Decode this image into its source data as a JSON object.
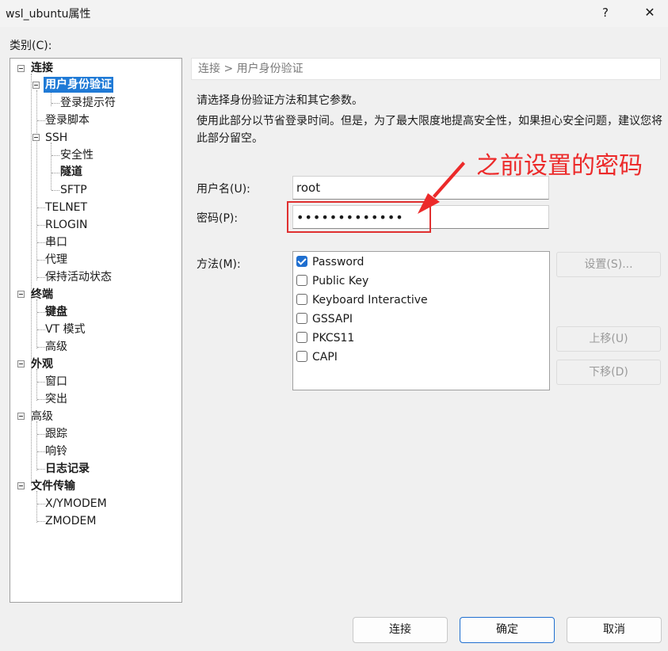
{
  "window": {
    "title": "wsl_ubuntu属性",
    "help_label": "?",
    "close_label": "✕"
  },
  "category_label": "类别(C):",
  "tree": {
    "items": [
      {
        "label": "连接"
      },
      {
        "label": "用户身份验证"
      },
      {
        "label": "登录提示符"
      },
      {
        "label": "登录脚本"
      },
      {
        "label": "SSH"
      },
      {
        "label": "安全性"
      },
      {
        "label": "隧道"
      },
      {
        "label": "SFTP"
      },
      {
        "label": "TELNET"
      },
      {
        "label": "RLOGIN"
      },
      {
        "label": "串口"
      },
      {
        "label": "代理"
      },
      {
        "label": "保持活动状态"
      },
      {
        "label": "终端"
      },
      {
        "label": "键盘"
      },
      {
        "label": "VT 模式"
      },
      {
        "label": "高级"
      },
      {
        "label": "外观"
      },
      {
        "label": "窗口"
      },
      {
        "label": "突出"
      },
      {
        "label": "高级"
      },
      {
        "label": "跟踪"
      },
      {
        "label": "响铃"
      },
      {
        "label": "日志记录"
      },
      {
        "label": "文件传输"
      },
      {
        "label": "X/YMODEM"
      },
      {
        "label": "ZMODEM"
      }
    ]
  },
  "breadcrumb": "连接 > 用户身份验证",
  "description": {
    "line1": "请选择身份验证方法和其它参数。",
    "line2": "使用此部分以节省登录时间。但是，为了最大限度地提高安全性，如果担心安全问题，建议您将此部分留空。"
  },
  "annotation": "之前设置的密码",
  "form": {
    "username_label": "用户名(U):",
    "username_value": "root",
    "password_label": "密码(P):",
    "password_value": "•••••••••••••",
    "method_label": "方法(M):"
  },
  "methods": [
    {
      "label": "Password",
      "checked": true
    },
    {
      "label": "Public Key",
      "checked": false
    },
    {
      "label": "Keyboard Interactive",
      "checked": false
    },
    {
      "label": "GSSAPI",
      "checked": false
    },
    {
      "label": "PKCS11",
      "checked": false
    },
    {
      "label": "CAPI",
      "checked": false
    }
  ],
  "side_buttons": {
    "settings": "设置(S)...",
    "move_up": "上移(U)",
    "move_down": "下移(D)"
  },
  "footer": {
    "connect": "连接",
    "ok": "确定",
    "cancel": "取消"
  },
  "colors": {
    "accent": "#1f6fd0",
    "selection": "#1f7ad6",
    "annotation": "#ec2a2a"
  }
}
